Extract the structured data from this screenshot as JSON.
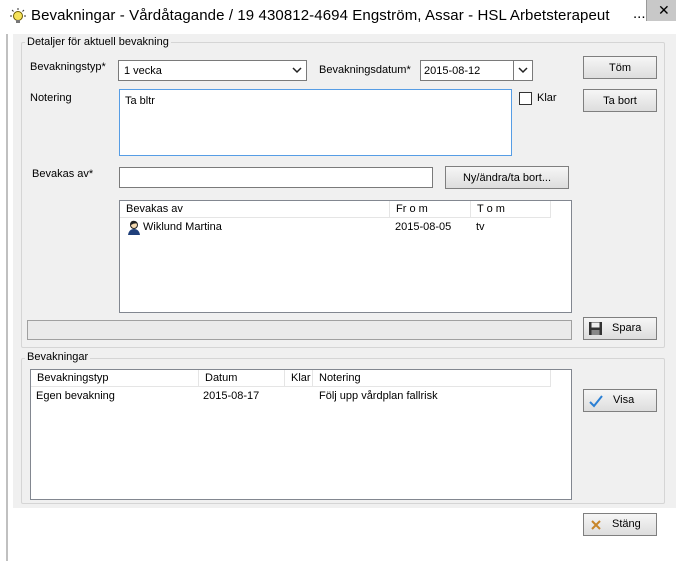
{
  "window": {
    "title": "Bevakningar - Vårdåtagande /  19 430812-4694   Engström, Assar   -   HSL Arbetsterapeut",
    "title_ellipsis": "...",
    "close_glyph": "✕"
  },
  "details": {
    "group_label": "Detaljer för aktuell bevakning",
    "type_label": "Bevakningstyp*",
    "type_value": "1 vecka",
    "date_label": "Bevakningsdatum*",
    "date_value": "2015-08-12",
    "note_label": "Notering",
    "note_value": "Ta bltr",
    "done_label": "Klar",
    "done_checked": false,
    "watched_by_label": "Bevakas av*",
    "watched_by_value": "",
    "new_change_button": "Ny/ändra/ta bort...",
    "clear_button": "Töm",
    "delete_button": "Ta bort",
    "save_button": "Spara",
    "watchers_table": {
      "columns": [
        "Bevakas av",
        "Fr o m",
        "T o m"
      ],
      "rows": [
        {
          "name": "Wiklund Martina",
          "from": "2015-08-05",
          "to": "tv",
          "icon": "user-icon"
        }
      ]
    }
  },
  "watches": {
    "group_label": "Bevakningar",
    "show_button": "Visa",
    "table": {
      "columns": [
        "Bevakningstyp",
        "Datum",
        "Klar",
        "Notering"
      ],
      "rows": [
        {
          "type": "Egen bevakning",
          "date": "2015-08-17",
          "done": "",
          "note": "Följ upp vårdplan fallrisk"
        }
      ]
    }
  },
  "footer": {
    "close_button": "Stäng"
  },
  "colors": {
    "client_bg": "#f0f0f0",
    "check_blue": "#2a7fd4",
    "close_x": "#c8862a"
  }
}
